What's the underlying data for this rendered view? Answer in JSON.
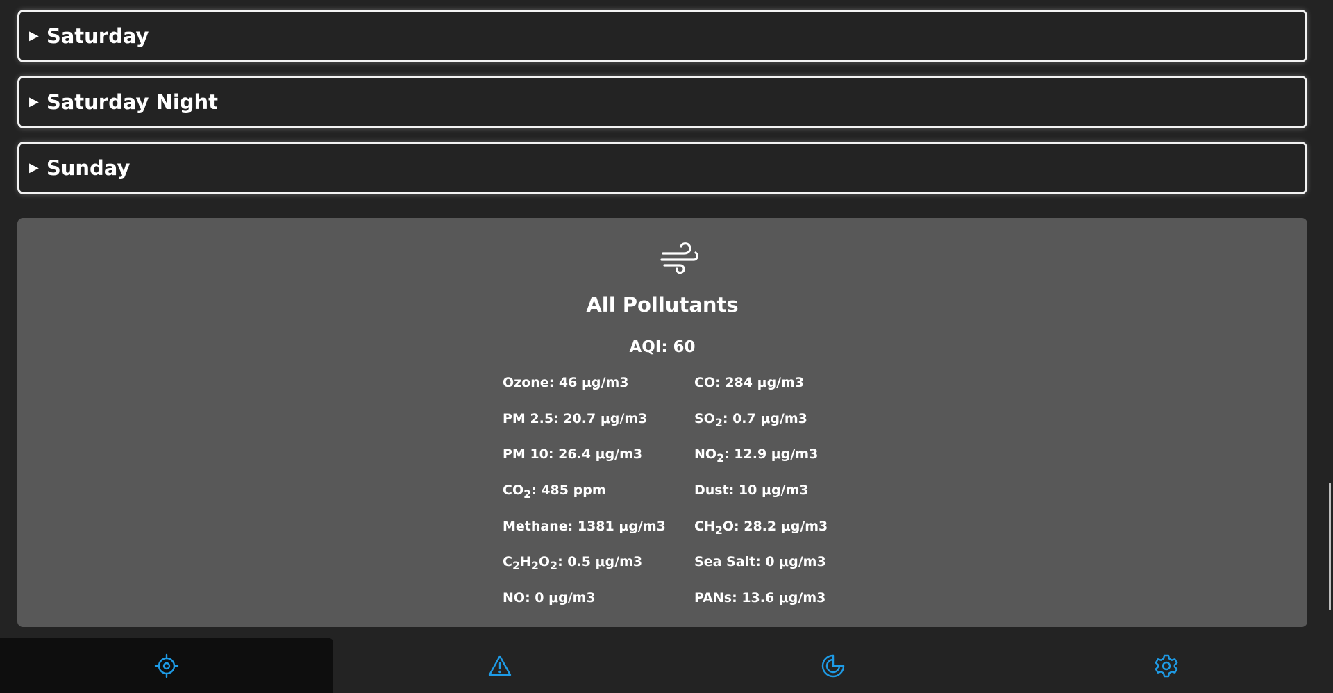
{
  "forecast": {
    "days": [
      {
        "caret": "▶",
        "label": "Saturday"
      },
      {
        "caret": "▶",
        "label": "Saturday Night"
      },
      {
        "caret": "▶",
        "label": "Sunday"
      }
    ]
  },
  "pollutants": {
    "icon": "wind-icon",
    "title": "All Pollutants",
    "aqi": "AQI: 60",
    "left": [
      {
        "name": "Ozone",
        "value": ": 46 μg/m3"
      },
      {
        "name": "PM 2.5",
        "value": ": 20.7 μg/m3"
      },
      {
        "name": "PM 10",
        "value": ": 26.4 μg/m3"
      },
      {
        "name": "CO",
        "sub": "2",
        "value": ": 485 ppm"
      },
      {
        "name": "Methane",
        "value": ": 1381 μg/m3"
      },
      {
        "name": "C",
        "sub": "2",
        "name2": "H",
        "sub2": "2",
        "name3": "O",
        "sub3": "2",
        "value": ": 0.5 μg/m3"
      },
      {
        "name": "NO",
        "value": ": 0 μg/m3"
      }
    ],
    "right": [
      {
        "name": "CO",
        "value": ": 284 μg/m3"
      },
      {
        "name": "SO",
        "sub": "2",
        "value": ": 0.7 μg/m3"
      },
      {
        "name": "NO",
        "sub": "2",
        "value": ": 12.9 μg/m3"
      },
      {
        "name": "Dust",
        "value": ": 10 μg/m3"
      },
      {
        "name": "CH",
        "sub": "2",
        "name2": "O",
        "value": ": 28.2 μg/m3"
      },
      {
        "name": "Sea Salt",
        "value": ": 0 μg/m3"
      },
      {
        "name": "PANs",
        "value": ": 13.6 μg/m3"
      }
    ]
  },
  "nav": {
    "items": [
      {
        "icon": "crosshair-icon",
        "active": true
      },
      {
        "icon": "warning-triangle-icon",
        "active": false
      },
      {
        "icon": "radar-icon",
        "active": false
      },
      {
        "icon": "gear-icon",
        "active": false
      }
    ],
    "accent_color": "#1e9be6"
  }
}
